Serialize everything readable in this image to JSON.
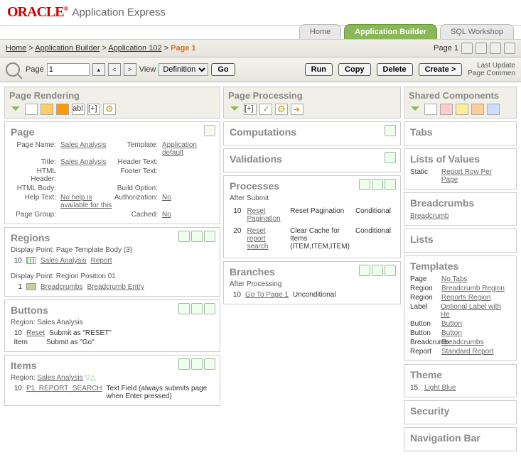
{
  "brand": {
    "logo": "ORACLE",
    "reg": "®",
    "product": "Application Express"
  },
  "main_tabs": [
    {
      "label": "Home"
    },
    {
      "label": "Application Builder",
      "active": true
    },
    {
      "label": "SQL Workshop"
    }
  ],
  "breadcrumb": {
    "items": [
      "Home",
      "Application Builder",
      "Application 102"
    ],
    "current": "Page 1",
    "page_label": "Page 1"
  },
  "toolbar": {
    "page_label": "Page",
    "page_value": "1",
    "view_label": "View",
    "view_value": "Definition",
    "go": "Go",
    "run": "Run",
    "copy": "Copy",
    "delete": "Delete",
    "create": "Create >",
    "right1": "Last Update",
    "right2": "Page Commen"
  },
  "col1_header": "Page Rendering",
  "col2_header": "Page Processing",
  "col3_header": "Shared Components",
  "page_panel": {
    "title": "Page",
    "rows": [
      {
        "l1": "Page Name:",
        "v1": "Sales Analysis",
        "link1": true,
        "l2": "Template:",
        "v2": "Application default",
        "link2": true
      },
      {
        "l1": "Title:",
        "v1": "Sales Analysis",
        "link1": true,
        "l2": "Header Text:",
        "v2": ""
      },
      {
        "l1": "HTML Header:",
        "v1": "",
        "l2": "Footer Text:",
        "v2": ""
      },
      {
        "l1": "HTML Body:",
        "v1": "",
        "l2": "Build Option:",
        "v2": ""
      },
      {
        "l1": "Help Text:",
        "v1": "No help is available for this",
        "link1": true,
        "l2": "Authorization:",
        "v2": "No",
        "link2": true
      },
      {
        "l1": "Page Group:",
        "v1": "",
        "l2": "Cached:",
        "v2": "No",
        "link2": true
      }
    ]
  },
  "regions": {
    "title": "Regions",
    "dp1": "Display Point: Page Template Body (3)",
    "r1_seq": "10",
    "r1_a": "Sales Analysis",
    "r1_b": "Report",
    "dp2": "Display Point: Region Position 01",
    "r2_seq": "1",
    "r2_a": "Breadcrumbs",
    "r2_b": "Breadcrumb Entry"
  },
  "buttons": {
    "title": "Buttons",
    "region": "Region: Sales Analysis",
    "r1_seq": "10",
    "r1_a": "Reset",
    "r1_b": "Submit as \"RESET\"",
    "r2_seq": "Item",
    "r2_b": "Submit as \"Go\""
  },
  "items": {
    "title": "Items",
    "region": "Region:",
    "region_link": "Sales Analysis",
    "r1_seq": "10",
    "r1_a": "P1_REPORT_SEARCH",
    "r1_b": "Text Field (always submits page when Enter pressed)"
  },
  "computations": {
    "title": "Computations"
  },
  "validations": {
    "title": "Validations"
  },
  "processes": {
    "title": "Processes",
    "sub": "After Submit",
    "rows": [
      {
        "seq": "10",
        "name": "Reset Pagination",
        "type": "Reset Pagination",
        "cond": "Conditional"
      },
      {
        "seq": "20",
        "name": "Reset report search",
        "type": "Clear Cache for Items (ITEM,ITEM,ITEM)",
        "cond": "Conditional"
      }
    ]
  },
  "branches": {
    "title": "Branches",
    "sub": "After Processing",
    "seq": "10",
    "name": "Go To Page  1",
    "cond": "Unconditional"
  },
  "tabs": {
    "title": "Tabs"
  },
  "lov": {
    "title": "Lists of Values",
    "k": "Static",
    "v": "Report Row Per Page"
  },
  "bcp": {
    "title": "Breadcrumbs",
    "v": "Breadcrumb"
  },
  "lists": {
    "title": "Lists"
  },
  "templates": {
    "title": "Templates",
    "rows": [
      {
        "k": "Page",
        "v": "No Tabs"
      },
      {
        "k": "Region",
        "v": "Breadcrumb Region"
      },
      {
        "k": "Region",
        "v": "Reports Region"
      },
      {
        "k": "Label",
        "v": "Optional Label with He"
      },
      {
        "k": "Button",
        "v": "Button"
      },
      {
        "k": "Button",
        "v": "Button"
      },
      {
        "k": "Breadcrumb",
        "v": "Breadcrumbs"
      },
      {
        "k": "Report",
        "v": "Standard Report"
      }
    ]
  },
  "theme": {
    "title": "Theme",
    "k": "15.",
    "v": "Light Blue"
  },
  "security": {
    "title": "Security"
  },
  "navbar": {
    "title": "Navigation Bar"
  }
}
